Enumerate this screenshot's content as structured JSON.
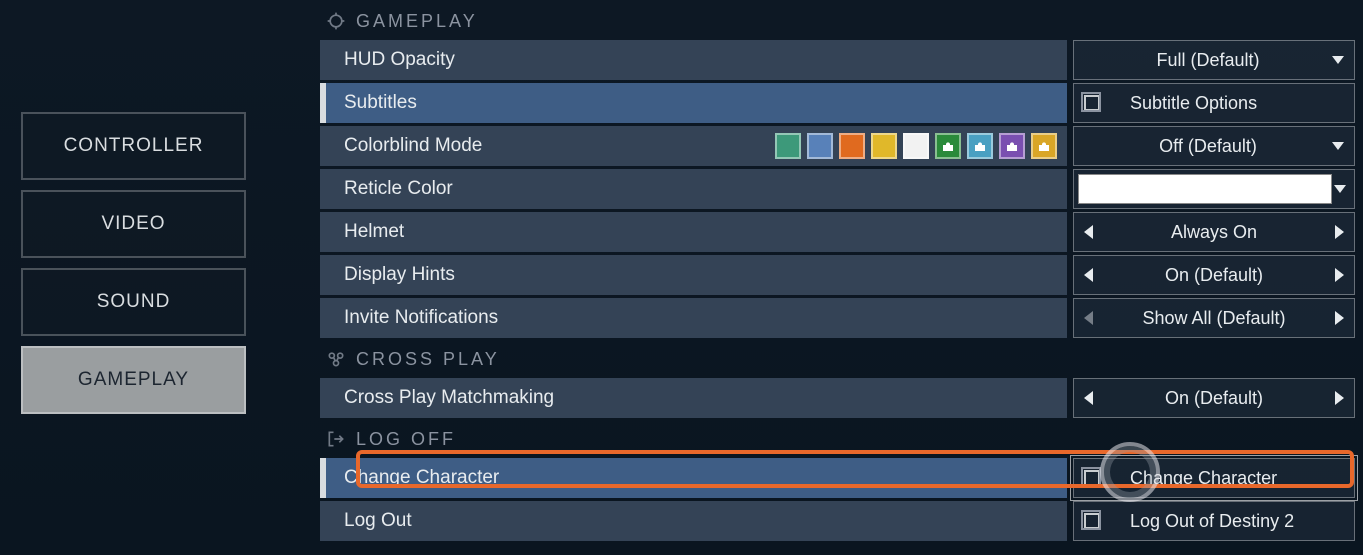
{
  "sidebar": {
    "items": [
      {
        "label": "CONTROLLER"
      },
      {
        "label": "VIDEO"
      },
      {
        "label": "SOUND"
      },
      {
        "label": "GAMEPLAY"
      }
    ],
    "active_index": 3
  },
  "sections": {
    "gameplay": {
      "header": "GAMEPLAY",
      "rows": {
        "hud_opacity": {
          "label": "HUD Opacity",
          "value": "Full (Default)"
        },
        "subtitles": {
          "label": "Subtitles",
          "value": "Subtitle Options"
        },
        "colorblind": {
          "label": "Colorblind Mode",
          "value": "Off (Default)"
        },
        "reticle_color": {
          "label": "Reticle Color",
          "value": "#ffffff"
        },
        "helmet": {
          "label": "Helmet",
          "value": "Always On"
        },
        "display_hints": {
          "label": "Display Hints",
          "value": "On (Default)"
        },
        "invite_notif": {
          "label": "Invite Notifications",
          "value": "Show All (Default)"
        }
      },
      "colorblind_swatches": [
        "#3d997a",
        "#5881b9",
        "#e06a1f",
        "#e0b82a",
        "#f2f2f2",
        "#2a8a3a",
        "#4aa0c2",
        "#7a4fb0",
        "#d9a627"
      ]
    },
    "crossplay": {
      "header": "CROSS PLAY",
      "rows": {
        "matchmaking": {
          "label": "Cross Play Matchmaking",
          "value": "On (Default)"
        }
      }
    },
    "logoff": {
      "header": "LOG OFF",
      "rows": {
        "change_char": {
          "label": "Change Character",
          "value": "Change Character"
        },
        "log_out": {
          "label": "Log Out",
          "value": "Log Out of Destiny 2"
        }
      }
    }
  }
}
